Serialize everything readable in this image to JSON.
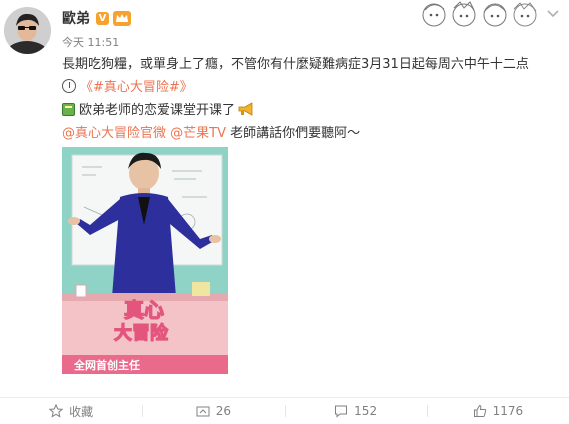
{
  "header": {
    "username": "歐弟",
    "verified_badge": "V",
    "timestamp": "今天 11:51",
    "more_icon": "chevron-down-icon"
  },
  "post": {
    "line1": "長期吃狗糧，或單身上了癮，不管你有什麼疑難病症3月31日起每周六中午十二点",
    "topic": "《#真心大冒险#》",
    "line3": "欧弟老师的恋爱课堂开课了",
    "mention1": "@真心大冒险官微",
    "mention2": "@芒果TV",
    "line4_tail": " 老師講話你們要聽阿～"
  },
  "media": {
    "show_title_1": "真心",
    "show_title_2": "大冒险",
    "bottom_caption": "全网首创主任"
  },
  "footer": {
    "favorite_label": "收藏",
    "forward_count": "26",
    "comment_count": "152",
    "like_count": "1176"
  },
  "colors": {
    "link": "#eb7350",
    "text": "#333333",
    "muted": "#808080",
    "badge": "#f7a12f"
  }
}
